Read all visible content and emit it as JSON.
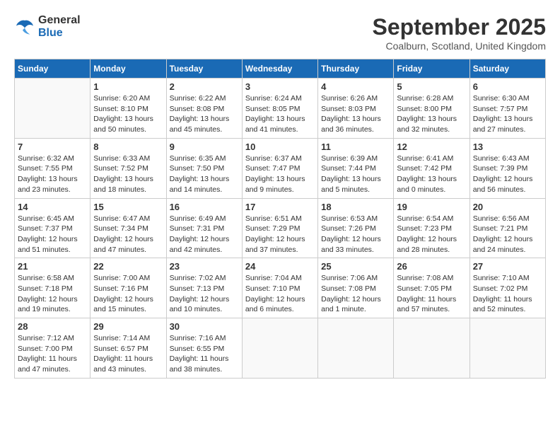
{
  "header": {
    "logo_line1": "General",
    "logo_line2": "Blue",
    "month": "September 2025",
    "location": "Coalburn, Scotland, United Kingdom"
  },
  "weekdays": [
    "Sunday",
    "Monday",
    "Tuesday",
    "Wednesday",
    "Thursday",
    "Friday",
    "Saturday"
  ],
  "weeks": [
    [
      {
        "day": "",
        "info": ""
      },
      {
        "day": "1",
        "info": "Sunrise: 6:20 AM\nSunset: 8:10 PM\nDaylight: 13 hours\nand 50 minutes."
      },
      {
        "day": "2",
        "info": "Sunrise: 6:22 AM\nSunset: 8:08 PM\nDaylight: 13 hours\nand 45 minutes."
      },
      {
        "day": "3",
        "info": "Sunrise: 6:24 AM\nSunset: 8:05 PM\nDaylight: 13 hours\nand 41 minutes."
      },
      {
        "day": "4",
        "info": "Sunrise: 6:26 AM\nSunset: 8:03 PM\nDaylight: 13 hours\nand 36 minutes."
      },
      {
        "day": "5",
        "info": "Sunrise: 6:28 AM\nSunset: 8:00 PM\nDaylight: 13 hours\nand 32 minutes."
      },
      {
        "day": "6",
        "info": "Sunrise: 6:30 AM\nSunset: 7:57 PM\nDaylight: 13 hours\nand 27 minutes."
      }
    ],
    [
      {
        "day": "7",
        "info": "Sunrise: 6:32 AM\nSunset: 7:55 PM\nDaylight: 13 hours\nand 23 minutes."
      },
      {
        "day": "8",
        "info": "Sunrise: 6:33 AM\nSunset: 7:52 PM\nDaylight: 13 hours\nand 18 minutes."
      },
      {
        "day": "9",
        "info": "Sunrise: 6:35 AM\nSunset: 7:50 PM\nDaylight: 13 hours\nand 14 minutes."
      },
      {
        "day": "10",
        "info": "Sunrise: 6:37 AM\nSunset: 7:47 PM\nDaylight: 13 hours\nand 9 minutes."
      },
      {
        "day": "11",
        "info": "Sunrise: 6:39 AM\nSunset: 7:44 PM\nDaylight: 13 hours\nand 5 minutes."
      },
      {
        "day": "12",
        "info": "Sunrise: 6:41 AM\nSunset: 7:42 PM\nDaylight: 13 hours\nand 0 minutes."
      },
      {
        "day": "13",
        "info": "Sunrise: 6:43 AM\nSunset: 7:39 PM\nDaylight: 12 hours\nand 56 minutes."
      }
    ],
    [
      {
        "day": "14",
        "info": "Sunrise: 6:45 AM\nSunset: 7:37 PM\nDaylight: 12 hours\nand 51 minutes."
      },
      {
        "day": "15",
        "info": "Sunrise: 6:47 AM\nSunset: 7:34 PM\nDaylight: 12 hours\nand 47 minutes."
      },
      {
        "day": "16",
        "info": "Sunrise: 6:49 AM\nSunset: 7:31 PM\nDaylight: 12 hours\nand 42 minutes."
      },
      {
        "day": "17",
        "info": "Sunrise: 6:51 AM\nSunset: 7:29 PM\nDaylight: 12 hours\nand 37 minutes."
      },
      {
        "day": "18",
        "info": "Sunrise: 6:53 AM\nSunset: 7:26 PM\nDaylight: 12 hours\nand 33 minutes."
      },
      {
        "day": "19",
        "info": "Sunrise: 6:54 AM\nSunset: 7:23 PM\nDaylight: 12 hours\nand 28 minutes."
      },
      {
        "day": "20",
        "info": "Sunrise: 6:56 AM\nSunset: 7:21 PM\nDaylight: 12 hours\nand 24 minutes."
      }
    ],
    [
      {
        "day": "21",
        "info": "Sunrise: 6:58 AM\nSunset: 7:18 PM\nDaylight: 12 hours\nand 19 minutes."
      },
      {
        "day": "22",
        "info": "Sunrise: 7:00 AM\nSunset: 7:16 PM\nDaylight: 12 hours\nand 15 minutes."
      },
      {
        "day": "23",
        "info": "Sunrise: 7:02 AM\nSunset: 7:13 PM\nDaylight: 12 hours\nand 10 minutes."
      },
      {
        "day": "24",
        "info": "Sunrise: 7:04 AM\nSunset: 7:10 PM\nDaylight: 12 hours\nand 6 minutes."
      },
      {
        "day": "25",
        "info": "Sunrise: 7:06 AM\nSunset: 7:08 PM\nDaylight: 12 hours\nand 1 minute."
      },
      {
        "day": "26",
        "info": "Sunrise: 7:08 AM\nSunset: 7:05 PM\nDaylight: 11 hours\nand 57 minutes."
      },
      {
        "day": "27",
        "info": "Sunrise: 7:10 AM\nSunset: 7:02 PM\nDaylight: 11 hours\nand 52 minutes."
      }
    ],
    [
      {
        "day": "28",
        "info": "Sunrise: 7:12 AM\nSunset: 7:00 PM\nDaylight: 11 hours\nand 47 minutes."
      },
      {
        "day": "29",
        "info": "Sunrise: 7:14 AM\nSunset: 6:57 PM\nDaylight: 11 hours\nand 43 minutes."
      },
      {
        "day": "30",
        "info": "Sunrise: 7:16 AM\nSunset: 6:55 PM\nDaylight: 11 hours\nand 38 minutes."
      },
      {
        "day": "",
        "info": ""
      },
      {
        "day": "",
        "info": ""
      },
      {
        "day": "",
        "info": ""
      },
      {
        "day": "",
        "info": ""
      }
    ]
  ]
}
